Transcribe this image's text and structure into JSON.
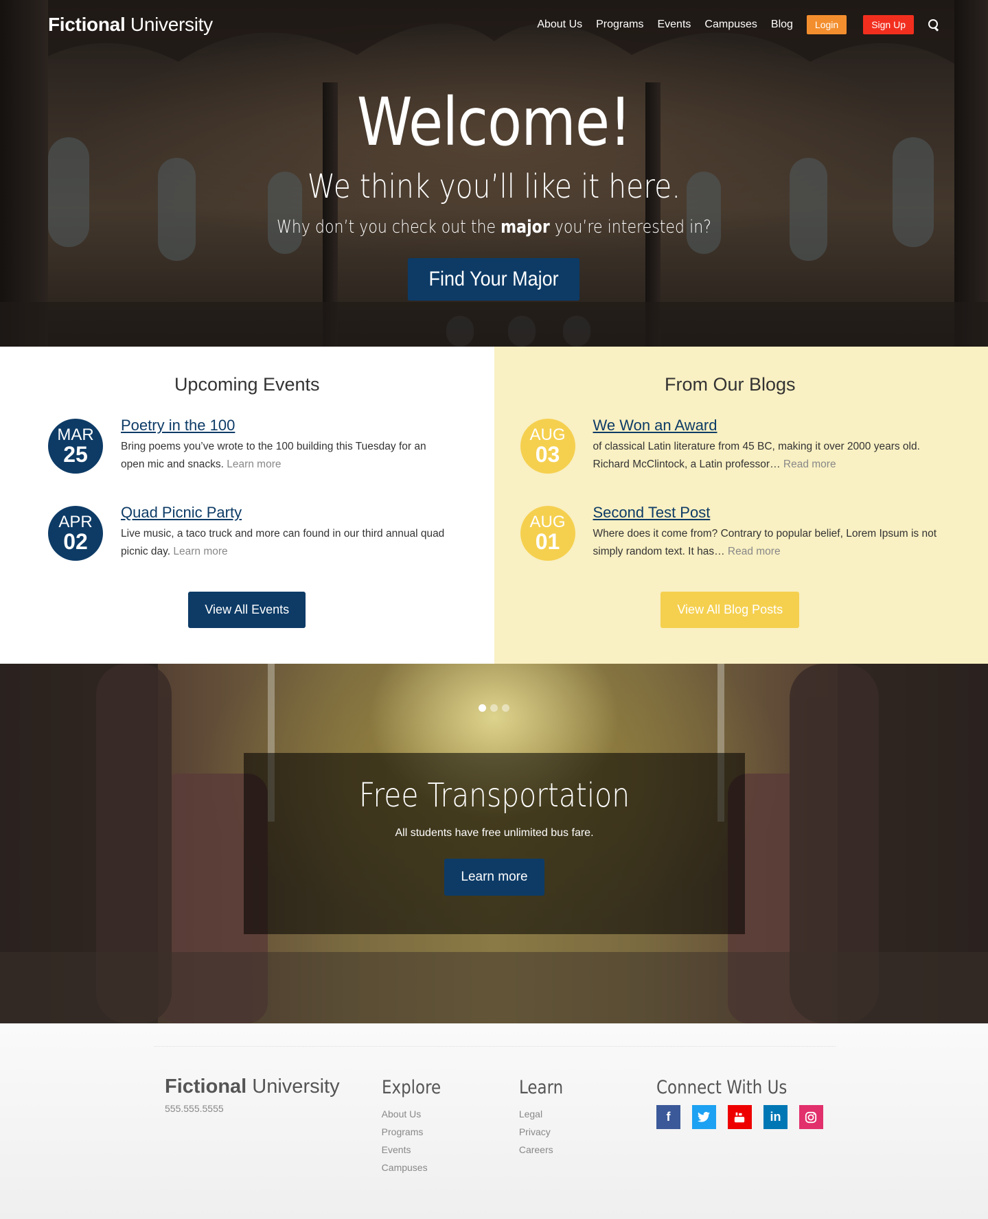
{
  "header": {
    "logo_bold": "Fictional",
    "logo_light": "University",
    "nav": [
      "About Us",
      "Programs",
      "Events",
      "Campuses",
      "Blog"
    ],
    "login_label": "Login",
    "signup_label": "Sign Up",
    "search_icon": "search-icon"
  },
  "hero": {
    "title": "Welcome!",
    "subtitle": "We think you’ll like it here.",
    "line_pre": "Why don’t you check out the",
    "line_bold": "major",
    "line_post": "you’re interested in?",
    "cta": "Find Your Major"
  },
  "events": {
    "heading": "Upcoming Events",
    "items": [
      {
        "month": "MAR",
        "day": "25",
        "title": "Poetry in the 100",
        "desc": "Bring poems you’ve wrote to the 100 building this Tuesday for an open mic and snacks.",
        "more": "Learn more"
      },
      {
        "month": "APR",
        "day": "02",
        "title": "Quad Picnic Party",
        "desc": "Live music, a taco truck and more can found in our third annual quad picnic day.",
        "more": "Learn more"
      }
    ],
    "button": "View All Events"
  },
  "blogs": {
    "heading": "From Our Blogs",
    "items": [
      {
        "month": "AUG",
        "day": "03",
        "title": "We Won an Award",
        "desc": "of classical Latin literature from 45 BC, making it over 2000 years old. Richard McClintock, a Latin professor…",
        "more": "Read more"
      },
      {
        "month": "AUG",
        "day": "01",
        "title": "Second Test Post",
        "desc": "Where does it come from? Contrary to popular belief, Lorem Ipsum is not simply random text. It has…",
        "more": "Read more"
      }
    ],
    "button": "View All Blog Posts"
  },
  "slider": {
    "title": "Free Transportation",
    "text": "All students have free unlimited bus fare.",
    "button": "Learn more",
    "active_slide": 1,
    "slide_count": 3
  },
  "footer": {
    "logo_bold": "Fictional",
    "logo_light": "University",
    "phone": "555.555.5555",
    "explore": {
      "heading": "Explore",
      "links": [
        "About Us",
        "Programs",
        "Events",
        "Campuses"
      ]
    },
    "learn": {
      "heading": "Learn",
      "links": [
        "Legal",
        "Privacy",
        "Careers"
      ]
    },
    "connect": {
      "heading": "Connect With Us",
      "icons": [
        "facebook-icon",
        "twitter-icon",
        "youtube-icon",
        "linkedin-icon",
        "instagram-icon"
      ]
    }
  },
  "colors": {
    "primary": "#0d3b66",
    "yellow": "#f5d04f",
    "blog_bg": "#f9f0c3",
    "login": "#f38e2e",
    "signup": "#f22f1f"
  }
}
